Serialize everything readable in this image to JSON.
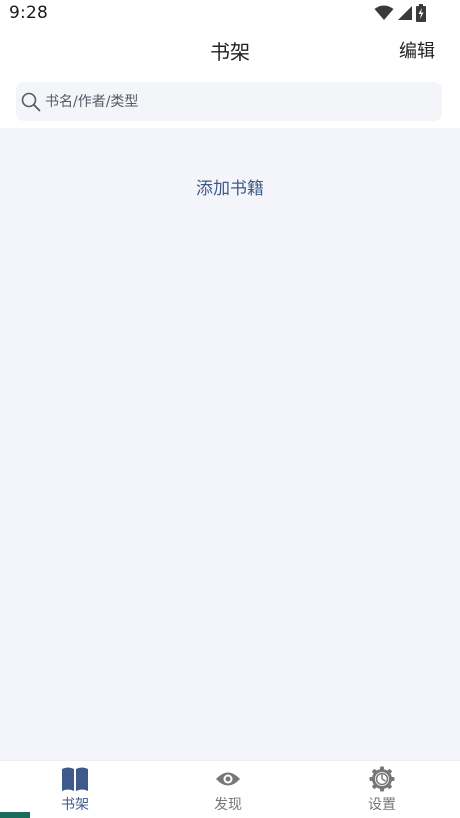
{
  "status_bar": {
    "time": "9:28",
    "icons": [
      "wifi-icon",
      "signal-icon",
      "battery-icon"
    ]
  },
  "header": {
    "title": "书架",
    "edit_label": "编辑"
  },
  "search": {
    "placeholder": "书名/作者/类型",
    "icon": "search-icon"
  },
  "content": {
    "add_books_label": "添加书籍"
  },
  "bottom_nav": {
    "items": [
      {
        "label": "书架",
        "icon": "book-icon",
        "active": true
      },
      {
        "label": "发现",
        "icon": "eye-icon",
        "active": false
      },
      {
        "label": "设置",
        "icon": "gear-icon",
        "active": false
      }
    ]
  },
  "colors": {
    "accent": "#3e5a8c",
    "inactive": "#777777",
    "content_bg": "#f4f5fa",
    "search_bg": "#f4f5f9"
  }
}
